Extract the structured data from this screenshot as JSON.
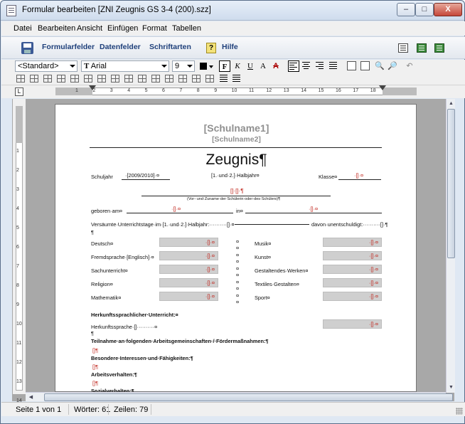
{
  "window": {
    "title": "Formular bearbeiten  [ZNI Zeugnis GS 3-4 (200).szz]",
    "controls": {
      "minimize": "–",
      "maximize": "□",
      "close": "X"
    }
  },
  "menu": [
    "Datei",
    "Bearbeiten",
    "Ansicht",
    "Einfügen",
    "Format",
    "Tabellen"
  ],
  "toolbar_main": {
    "formularfelder": "Formularfelder",
    "datenfelder": "Datenfelder",
    "schriftarten": "Schriftarten",
    "hilfe": "Hilfe",
    "help_glyph": "?"
  },
  "format_bar": {
    "style": "<Standard>",
    "font": "Arial",
    "font_prefix": "T",
    "size": "9",
    "btn_frame": "F",
    "btn_italic": "K",
    "btn_underline": "U",
    "btn_super": "A",
    "btn_strike": "A"
  },
  "ruler": {
    "numbers": [
      "1",
      "2",
      "3",
      "4",
      "5",
      "6",
      "7",
      "8",
      "9",
      "10",
      "11",
      "12",
      "13",
      "14",
      "15",
      "16",
      "17",
      "18"
    ],
    "vnumbers": [
      "1",
      "2",
      "3",
      "4",
      "5",
      "6",
      "7",
      "8",
      "9",
      "10",
      "11",
      "12",
      "13",
      "14"
    ],
    "corner": "L"
  },
  "document": {
    "schulname1": "[Schulname1]",
    "schulname2": "[Schulname2]",
    "title": "Zeugnis¶",
    "schuljahr_label": "Schuljahr",
    "schuljahr_value": "·[2009/2010]·¤",
    "halbjahr": "[1.·und·2.]·Halbjahr¤",
    "klasse_label": "Klasse¤",
    "klasse_field": "·[]·¤",
    "name_field": "[]·[]·¶",
    "name_caption": "(Vor-·und·Zuname·der·Schülerin·oder·des·Schülers)¶",
    "geboren_label": "geboren·am¤",
    "geboren_field": "·[]·¤",
    "in_label": "in¤",
    "in_field": "·[]·¤",
    "versaeumt": "Versäumte·Unterrichtstage·im·[1.·und·2.]·Halbjahr:··········[]·¤",
    "davon": "davon·unentschuldigt:··········[]·¶",
    "pilcrow": "¶",
    "subjects_left": [
      {
        "label": "Deutsch¤",
        "value": "·[]·¤"
      },
      {
        "label": "Fremdsprache·[Englisch]·¤",
        "value": "·[]·¤"
      },
      {
        "label": "Sachunterricht¤",
        "value": "·[]·¤"
      },
      {
        "label": "Religion¤",
        "value": "·[]·¤"
      },
      {
        "label": "Mathematik¤",
        "value": "·[]·¤"
      }
    ],
    "subjects_right": [
      {
        "label": "Musik¤",
        "value": "·[]·¤"
      },
      {
        "label": "Kunst¤",
        "value": "·[]·¤"
      },
      {
        "label": "Gestaltendes·Werken¤",
        "value": "·[]·¤"
      },
      {
        "label": "Textiles·Gestalten¤",
        "value": "·[]·¤"
      },
      {
        "label": "Sport¤",
        "value": "·[]·¤"
      }
    ],
    "cell_mark": "¤",
    "herkunft_heading": "Herkunftssprachlicher·Unterricht:¤",
    "herkunft_label": "Herkunftssprache·[]··········¤",
    "herkunft_value": "·[]·¤",
    "teilnahme": "Teilnahme·an·folgenden·Arbeitsgemeinschaften·/·Fördermaßnahmen:¶",
    "field_pilcrow": "[]¶",
    "besondere": "Besondere·Interessen·und·Fähigkeiten:¶",
    "arbeitsverhalten": "Arbeitsverhalten:¶",
    "sozialverhalten": "Sozialverhalten:¶"
  },
  "status": {
    "page": "Seite 1 von 1",
    "words": "Wörter: 61",
    "lines": "Zeilen: 79"
  },
  "colors": {
    "field_gray": "#cfcfcf",
    "placeholder_red": "#c0251c",
    "title_gray": "#909090"
  }
}
